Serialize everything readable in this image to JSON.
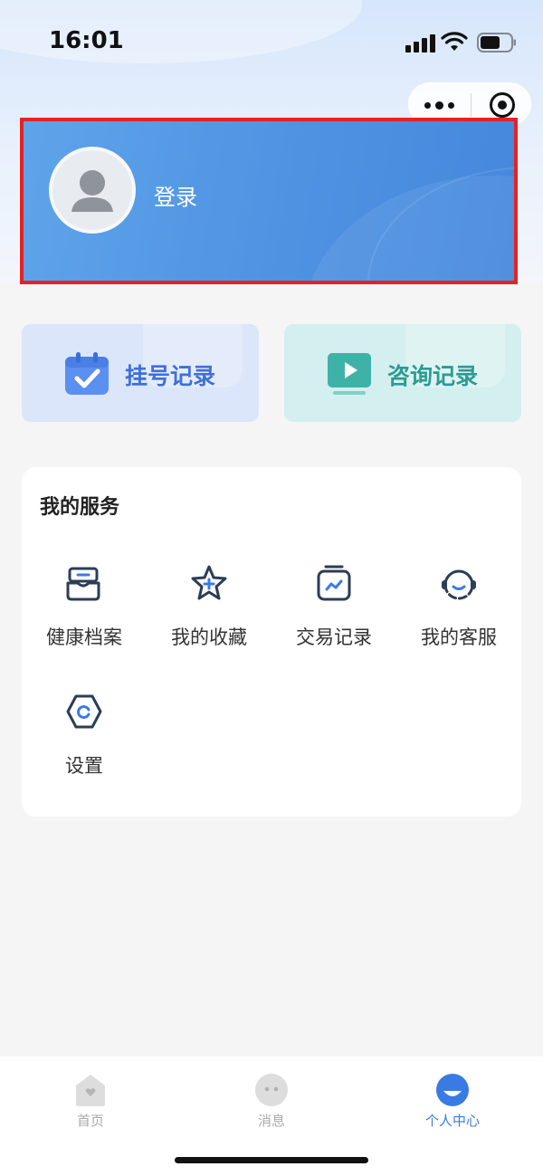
{
  "status_bar": {
    "time": "16:01"
  },
  "profile": {
    "login_label": "登录"
  },
  "records": [
    {
      "label": "挂号记录",
      "icon": "calendar-check-icon"
    },
    {
      "label": "咨询记录",
      "icon": "video-play-icon"
    }
  ],
  "services": {
    "title": "我的服务",
    "items": [
      {
        "label": "健康档案",
        "icon": "health-record-icon"
      },
      {
        "label": "我的收藏",
        "icon": "star-plus-icon"
      },
      {
        "label": "交易记录",
        "icon": "transaction-chart-icon"
      },
      {
        "label": "我的客服",
        "icon": "customer-service-icon"
      },
      {
        "label": "设置",
        "icon": "settings-hexagon-icon"
      }
    ]
  },
  "tabbar": {
    "items": [
      {
        "label": "首页",
        "icon": "home-heart-icon"
      },
      {
        "label": "消息",
        "icon": "message-dots-icon"
      },
      {
        "label": "个人中心",
        "icon": "profile-smile-icon"
      }
    ],
    "active_index": 2
  },
  "colors": {
    "accent": "#3a7be3",
    "login_card": "#4f92e2",
    "highlight_border": "#e52222",
    "registration_text": "#3f6fd8",
    "consult_text": "#2a9c93",
    "icon_stroke": "#2c3d57"
  }
}
